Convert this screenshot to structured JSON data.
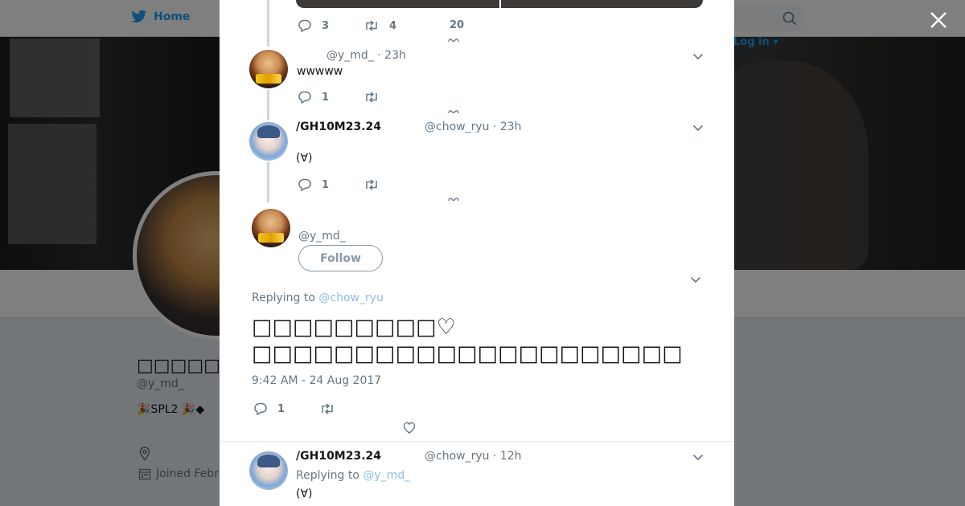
{
  "nav": {
    "home_label": "Home",
    "login_label": "Log in"
  },
  "profile": {
    "display_name": "□□□□□",
    "handle": "@y_md_",
    "bio": "🎉SPL2 🎉◆",
    "joined": "Joined Febru"
  },
  "tweets": [
    {
      "reply_count": "3",
      "retweet_count": "4",
      "like_count": "20"
    },
    {
      "handle_time": "@y_md_ · 23h",
      "text": "wwwww",
      "reply_count": "1"
    },
    {
      "name": "/GH10M23.24",
      "handle_time": "@chow_ryu · 23h",
      "text": "(∀)",
      "reply_count": "1"
    }
  ],
  "focused_tweet": {
    "handle": "@y_md_",
    "follow_label": "Follow",
    "replying_prefix": "Replying to",
    "replying_to": "@chow_ryu",
    "text_line1": "□□□□□□□□□♡",
    "text_line2": "□□□□□□□□□□□□□□□□□□□□□",
    "timestamp": "9:42 AM - 24 Aug 2017",
    "reply_count": "1"
  },
  "reply_tweet": {
    "name": "/GH10M23.24",
    "handle_time": "@chow_ryu · 12h",
    "replying_prefix": "Replying to",
    "replying_to": "@y_md_",
    "text": "(∀)"
  },
  "colors": {
    "brand": "#1da1f2",
    "secondary_text": "#657786",
    "link_muted": "#8ebce6"
  }
}
